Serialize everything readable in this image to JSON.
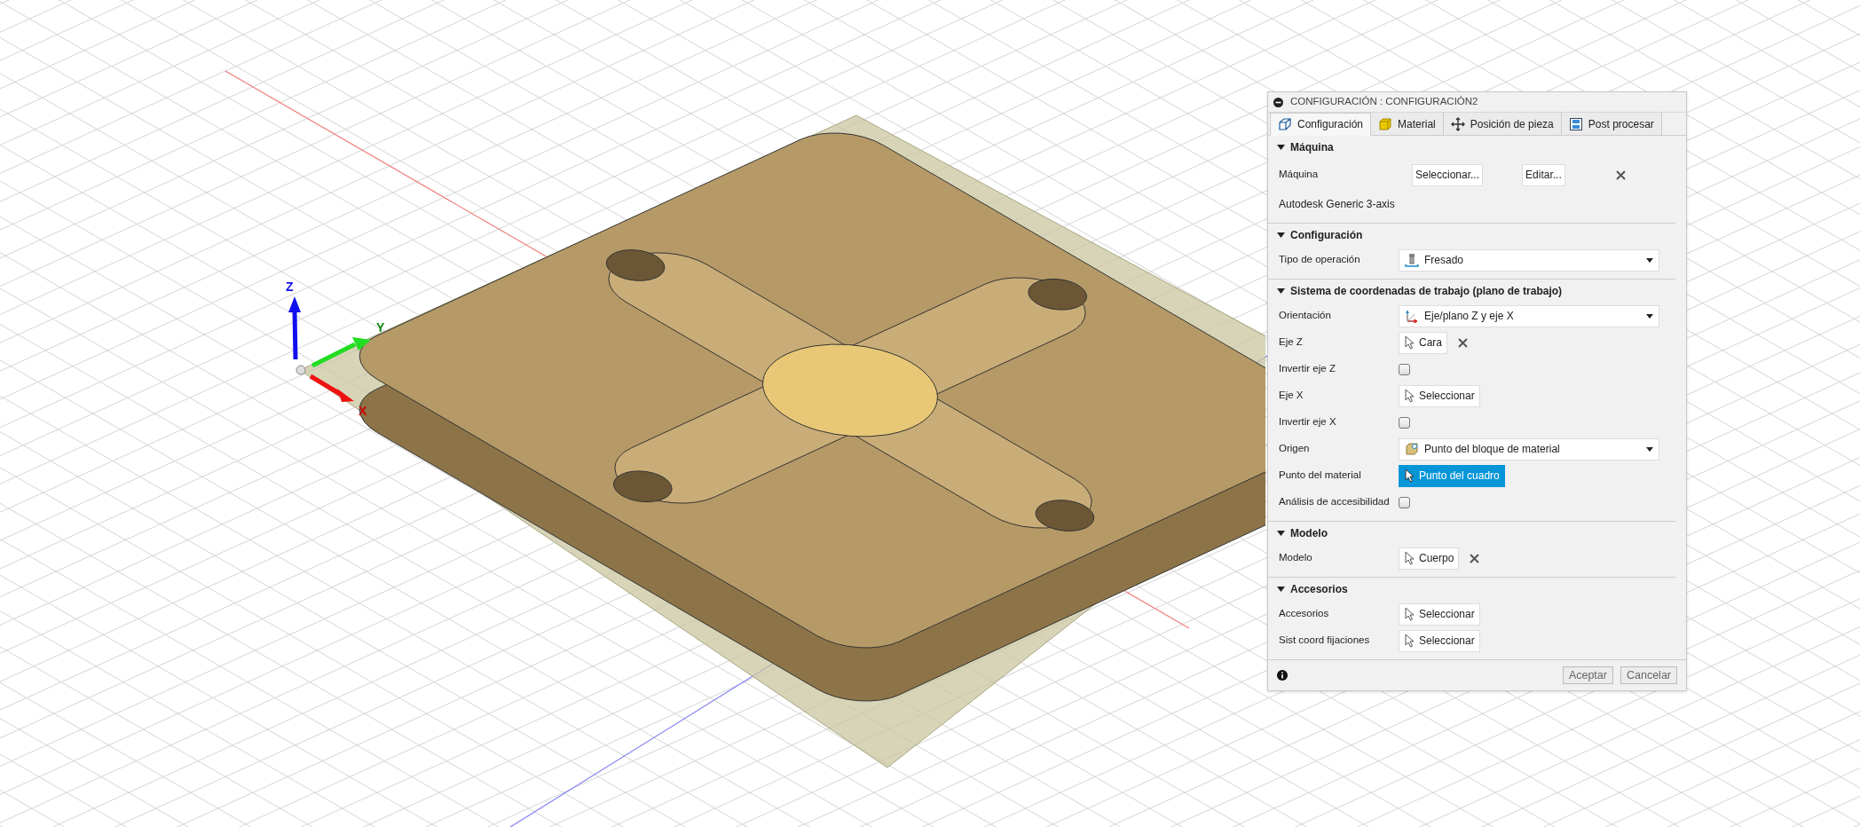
{
  "viewport": {
    "axis_labels": [
      "Z",
      "Y",
      "X"
    ]
  },
  "dialog": {
    "title": "CONFIGURACIÓN : CONFIGURACIÓN2",
    "tabs": [
      {
        "label": "Configuración",
        "selected": true
      },
      {
        "label": "Material",
        "selected": false
      },
      {
        "label": "Posición de pieza",
        "selected": false
      },
      {
        "label": "Post procesar",
        "selected": false
      }
    ],
    "sections": [
      {
        "title": "Máquina",
        "expanded": true,
        "rows": [
          {
            "kind": "machine",
            "label": "Máquina",
            "buttons": [
              "Seleccionar...",
              "Editar..."
            ],
            "clearable": true
          },
          {
            "kind": "text",
            "label": "Autodesk Generic 3-axis"
          }
        ]
      },
      {
        "title": "Configuración",
        "expanded": true,
        "rows": [
          {
            "kind": "dropdown",
            "label": "Tipo de operación",
            "value": "Fresado"
          }
        ]
      },
      {
        "title": "Sistema de coordenadas de trabajo (plano de trabajo)",
        "expanded": true,
        "rows": [
          {
            "kind": "dropdown",
            "label": "Orientación",
            "value": "Eje/plano Z y eje X"
          },
          {
            "kind": "select",
            "label": "Eje Z",
            "value": "Cara",
            "active": false,
            "clearable": true
          },
          {
            "kind": "checkbox",
            "label": "Invertir eje Z",
            "checked": false
          },
          {
            "kind": "select",
            "label": "Eje X",
            "value": "Seleccionar",
            "active": false,
            "clearable": false
          },
          {
            "kind": "checkbox",
            "label": "Invertir eje X",
            "checked": false
          },
          {
            "kind": "dropdown",
            "label": "Origen",
            "value": "Punto del bloque de material"
          },
          {
            "kind": "select",
            "label": "Punto del material",
            "value": "Punto del cuadro",
            "active": true,
            "clearable": false
          },
          {
            "kind": "checkbox",
            "label": "Análisis de accesibilidad",
            "checked": false
          }
        ]
      },
      {
        "title": "Modelo",
        "expanded": true,
        "rows": [
          {
            "kind": "select",
            "label": "Modelo",
            "value": "Cuerpo",
            "active": false,
            "clearable": true
          }
        ]
      },
      {
        "title": "Accesorios",
        "expanded": true,
        "rows": [
          {
            "kind": "select",
            "label": "Accesorios",
            "value": "Seleccionar",
            "active": false,
            "clearable": false
          },
          {
            "kind": "select",
            "label": "Sist coord fijaciones",
            "value": "Seleccionar",
            "active": false,
            "clearable": false
          }
        ]
      }
    ],
    "footer_buttons": [
      "Aceptar",
      "Cancelar"
    ]
  }
}
